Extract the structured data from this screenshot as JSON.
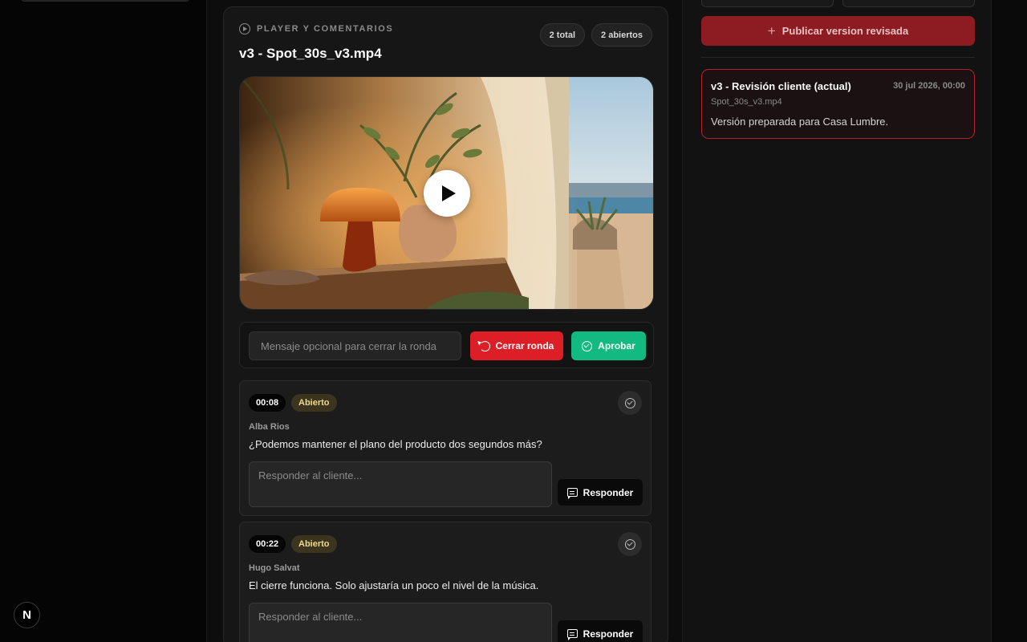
{
  "player": {
    "section_label": "PLAYER Y COMENTARIOS",
    "file_title": "v3 - Spot_30s_v3.mp4",
    "pill_total": "2 total",
    "pill_open": "2 abiertos"
  },
  "round": {
    "message_placeholder": "Mensaje opcional para cerrar la ronda",
    "close_label": "Cerrar ronda",
    "approve_label": "Aprobar"
  },
  "comments": [
    {
      "time": "00:08",
      "status": "Abierto",
      "author": "Alba Rios",
      "text": "¿Podemos mantener el plano del producto dos segundos más?",
      "reply_placeholder": "Responder al cliente...",
      "reply_label": "Responder"
    },
    {
      "time": "00:22",
      "status": "Abierto",
      "author": "Hugo Salvat",
      "text": "El cierre funciona. Solo ajustaría un poco el nivel de la música.",
      "reply_placeholder": "Responder al cliente...",
      "reply_label": "Responder"
    }
  ],
  "sidebar": {
    "publish_label": "Publicar version revisada",
    "version": {
      "title": "v3 - Revisión cliente (actual)",
      "date": "30 jul 2026, 00:00",
      "file": "Spot_30s_v3.mp4",
      "description": "Versión preparada para Casa Lumbre."
    }
  },
  "framework_badge": "N",
  "colors": {
    "danger": "#dc1f26",
    "success": "#12b981",
    "publish": "#8d1b22",
    "status_open_bg": "#3b3520",
    "status_open_text": "#f0d98a"
  },
  "icons": [
    "play-circle-icon",
    "play-icon",
    "reset-icon",
    "check-circle-icon",
    "chat-icon",
    "plus-icon"
  ]
}
